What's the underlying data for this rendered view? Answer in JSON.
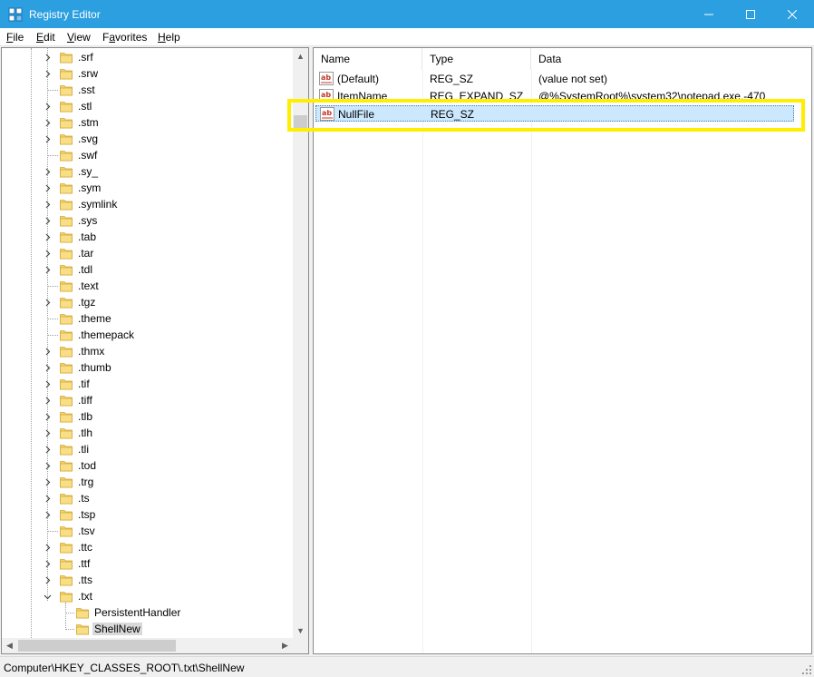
{
  "window": {
    "title": "Registry Editor"
  },
  "menu": [
    {
      "first": "F",
      "rest": "ile"
    },
    {
      "first": "E",
      "rest": "dit"
    },
    {
      "first": "V",
      "rest": "iew"
    },
    {
      "first": "F",
      "rest": "avorites",
      "pre": "",
      "label_full": "Favorites"
    },
    {
      "first": "H",
      "rest": "elp"
    }
  ],
  "tree": {
    "items": [
      {
        "label": ".srf",
        "expandable": true
      },
      {
        "label": ".srw",
        "expandable": true
      },
      {
        "label": ".sst",
        "expandable": false
      },
      {
        "label": ".stl",
        "expandable": true
      },
      {
        "label": ".stm",
        "expandable": true
      },
      {
        "label": ".svg",
        "expandable": true
      },
      {
        "label": ".swf",
        "expandable": false
      },
      {
        "label": ".sy_",
        "expandable": true
      },
      {
        "label": ".sym",
        "expandable": true
      },
      {
        "label": ".symlink",
        "expandable": true
      },
      {
        "label": ".sys",
        "expandable": true
      },
      {
        "label": ".tab",
        "expandable": true
      },
      {
        "label": ".tar",
        "expandable": true
      },
      {
        "label": ".tdl",
        "expandable": true
      },
      {
        "label": ".text",
        "expandable": false
      },
      {
        "label": ".tgz",
        "expandable": true
      },
      {
        "label": ".theme",
        "expandable": false
      },
      {
        "label": ".themepack",
        "expandable": false
      },
      {
        "label": ".thmx",
        "expandable": true
      },
      {
        "label": ".thumb",
        "expandable": true
      },
      {
        "label": ".tif",
        "expandable": true
      },
      {
        "label": ".tiff",
        "expandable": true
      },
      {
        "label": ".tlb",
        "expandable": true
      },
      {
        "label": ".tlh",
        "expandable": true
      },
      {
        "label": ".tli",
        "expandable": true
      },
      {
        "label": ".tod",
        "expandable": true
      },
      {
        "label": ".trg",
        "expandable": true
      },
      {
        "label": ".ts",
        "expandable": true
      },
      {
        "label": ".tsp",
        "expandable": true
      },
      {
        "label": ".tsv",
        "expandable": false
      },
      {
        "label": ".ttc",
        "expandable": true
      },
      {
        "label": ".ttf",
        "expandable": true
      },
      {
        "label": ".tts",
        "expandable": true
      },
      {
        "label": ".txt",
        "expandable": true,
        "expanded": true
      }
    ],
    "children": [
      {
        "label": "PersistentHandler",
        "selected": false
      },
      {
        "label": "ShellNew",
        "selected": true
      }
    ]
  },
  "values": {
    "columns": {
      "name": "Name",
      "type": "Type",
      "data": "Data"
    },
    "rows": [
      {
        "name": "(Default)",
        "type": "REG_SZ",
        "data": "(value not set)",
        "selected": false
      },
      {
        "name": "ItemName",
        "type": "REG_EXPAND_SZ",
        "data": "@%SystemRoot%\\system32\\notepad.exe,-470",
        "selected": false
      },
      {
        "name": "NullFile",
        "type": "REG_SZ",
        "data": "",
        "selected": true
      }
    ]
  },
  "status": {
    "path": "Computer\\HKEY_CLASSES_ROOT\\.txt\\ShellNew"
  },
  "colors": {
    "titlebar": "#2b9fe0",
    "folder": "#f3d36b",
    "highlight": "#ffee00",
    "selection": "#cce8ff"
  },
  "icons": {
    "app": "registry-editor-icon",
    "folder": "folder-icon",
    "string_value": "string-value-icon",
    "expand": "chevron-right-icon",
    "collapse": "chevron-down-icon"
  }
}
